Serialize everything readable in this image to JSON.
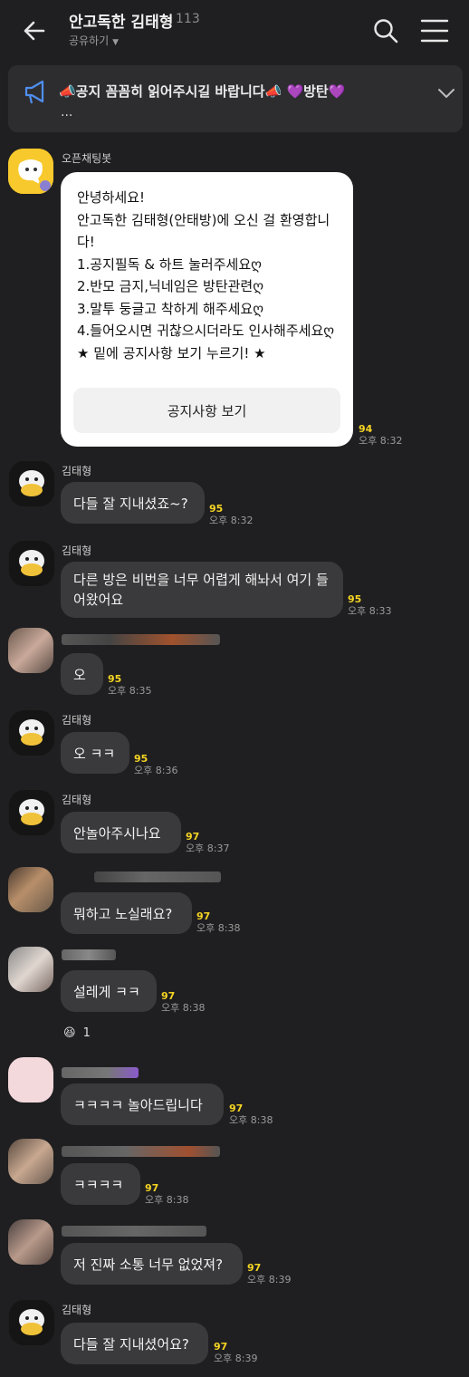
{
  "header": {
    "title": "안고독한 김태형",
    "member_count": "113",
    "share_label": "공유하기"
  },
  "notice": {
    "text": "📣공지 꼼꼼히 읽어주시길 바랍니다📣 💜방탄💜",
    "more": "..."
  },
  "bot": {
    "name": "오픈채팅봇",
    "message": "안녕하세요!\n안고독한 김태형(안태방)에 오신 걸 환영합니다!\n1.공지필독 & 하트 눌러주세요ღ\n2.반모 금지,닉네임은 방탄관련ღ\n3.말투 둥글고 착하게 해주세요ღ\n4.들어오시면 귀찮으시더라도 인사해주세요ღ\n★ 밑에 공지사항 보기 누르기! ★",
    "button_label": "공지사항 보기",
    "unread": "94",
    "time": "오후 8:32"
  },
  "messages": [
    {
      "sender": "김태형",
      "text": "다들 잘 지내셨죠~?",
      "unread": "95",
      "time": "오후 8:32"
    },
    {
      "sender": "김태형",
      "text": "다른 방은 비번을 너무 어렵게 해놔서 여기 들어왔어요",
      "unread": "95",
      "time": "오후 8:33"
    },
    {
      "sender": "",
      "text": "오",
      "unread": "95",
      "time": "오후 8:35"
    },
    {
      "sender": "김태형",
      "text": "오 ㅋㅋ",
      "unread": "95",
      "time": "오후 8:36"
    },
    {
      "sender": "김태형",
      "text": "안놀아주시나요",
      "unread": "97",
      "time": "오후 8:37"
    },
    {
      "sender": "",
      "text": "뭐하고 노실래요?",
      "unread": "97",
      "time": "오후 8:38"
    },
    {
      "sender": "",
      "text": "설레게 ㅋㅋ",
      "unread": "97",
      "time": "오후 8:38"
    },
    {
      "sender": "",
      "text": "ㅋㅋㅋㅋ 놀아드립니다",
      "unread": "97",
      "time": "오후 8:38"
    },
    {
      "sender": "",
      "text": "ㅋㅋㅋㅋ",
      "unread": "97",
      "time": "오후 8:38"
    },
    {
      "sender": "",
      "text": "저 진짜 소통 너무 없었져?",
      "unread": "97",
      "time": "오후 8:39"
    },
    {
      "sender": "김태형",
      "text": "다들 잘 지내셨어요?",
      "unread": "97",
      "time": "오후 8:39"
    }
  ],
  "reaction": {
    "emoji": "😆",
    "count": "1"
  },
  "colors": {
    "background": "#1f1f21",
    "bubble": "#3a3a3c",
    "unread": "#f5d423",
    "bot_avatar": "#f7c92c"
  },
  "icons": [
    "back-arrow-icon",
    "search-icon",
    "menu-icon",
    "megaphone-icon",
    "chevron-down-icon",
    "bot-avatar-icon",
    "duck-avatar-icon"
  ]
}
